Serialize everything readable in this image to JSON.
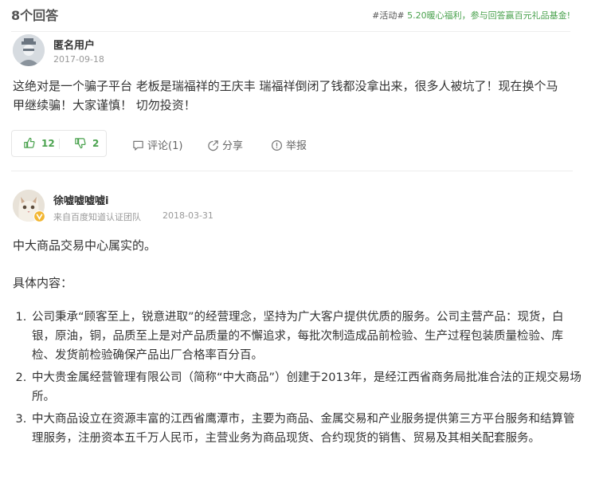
{
  "header": {
    "answer_count": "8个回答",
    "promo_tag": "#活动#",
    "promo_text": "5.20暖心福利，参与回答赢百元礼品基金!"
  },
  "answer1": {
    "username": "匿名用户",
    "date": "2017-09-18",
    "text": "这绝对是一个骗子平台 老板是瑞福祥的王庆丰 瑞福祥倒闭了钱都没拿出来，很多人被坑了！现在换个马甲继续骗！大家谨慎！ 切勿投资！",
    "likes": "12",
    "dislikes": "2",
    "comment_label": "评论(1)",
    "share_label": "分享",
    "report_label": "举报"
  },
  "answer2": {
    "username": "徐嘘嘘嘘嘘i",
    "source": "来自百度知道认证团队",
    "date": "2018-03-31",
    "intro": "中大商品交易中心属实的。",
    "content_heading": "具体内容：",
    "points": [
      "公司秉承“顾客至上，锐意进取”的经营理念，坚持为广大客户提供优质的服务。公司主营产品：现货，白银，原油，铜，品质至上是对产品质量的不懈追求，每批次制造成品前检验、生产过程包装质量检验、库检、发货前检验确保产品出厂合格率百分百。",
      "中大贵金属经营管理有限公司（简称“中大商品”）创建于2013年，是经江西省商务局批准合法的正规交易场所。",
      "中大商品设立在资源丰富的江西省鹰潭市，主要为商品、金属交易和产业服务提供第三方平台服务和结算管理服务，注册资本五千万人民币，主营业务为商品现货、合约现货的销售、贸易及其相关配套服务。"
    ]
  },
  "colors": {
    "accent": "#4aa24e",
    "muted": "#999999"
  }
}
